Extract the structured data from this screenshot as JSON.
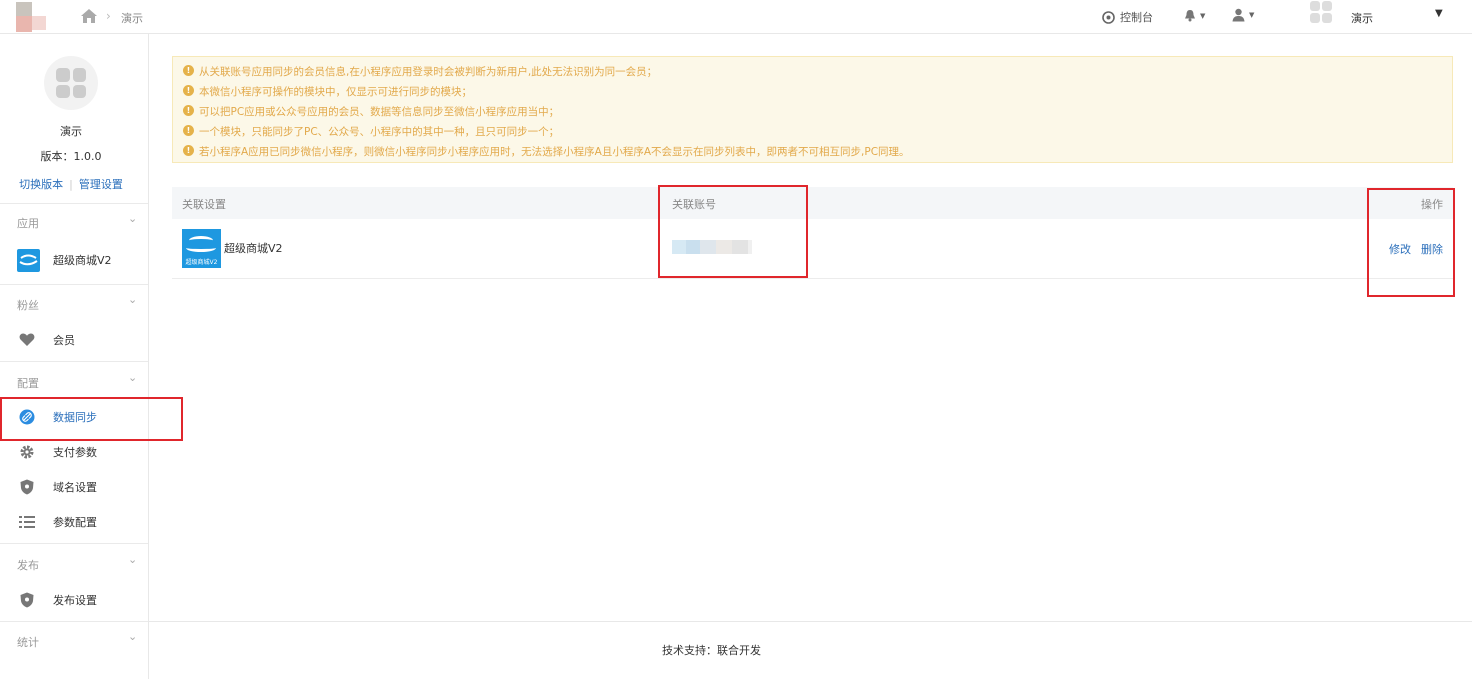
{
  "header": {
    "breadcrumb_current": "演示",
    "console_label": "控制台",
    "account_name": "演示"
  },
  "sidebar": {
    "app_name": "演示",
    "version": "版本：1.0.0",
    "switch_version": "切换版本",
    "manage_settings": "管理设置",
    "sections": [
      {
        "title": "应用",
        "items": [
          {
            "label": "超级商城V2",
            "icon": "app-logo-icon"
          }
        ]
      },
      {
        "title": "粉丝",
        "items": [
          {
            "label": "会员",
            "icon": "heart-icon"
          }
        ]
      },
      {
        "title": "配置",
        "items": [
          {
            "label": "数据同步",
            "icon": "link-icon",
            "active": true
          },
          {
            "label": "支付参数",
            "icon": "gear-icon"
          },
          {
            "label": "域名设置",
            "icon": "shield-icon"
          },
          {
            "label": "参数配置",
            "icon": "list-icon"
          }
        ]
      },
      {
        "title": "发布",
        "items": [
          {
            "label": "发布设置",
            "icon": "shield-icon"
          }
        ]
      },
      {
        "title": "统计",
        "items": []
      }
    ]
  },
  "notice": {
    "lines": [
      "从关联账号应用同步的会员信息,在小程序应用登录时会被判断为新用户,此处无法识别为同一会员；",
      "本微信小程序可操作的模块中，仅显示可进行同步的模块；",
      "可以把PC应用或公众号应用的会员、数据等信息同步至微信小程序应用当中；",
      "一个模块，只能同步了PC、公众号、小程序中的其中一种，且只可同步一个；",
      "若小程序A应用已同步微信小程序，则微信小程序同步小程序应用时，无法选择小程序A且小程序A不会显示在同步列表中，即两者不可相互同步,PC同理。"
    ]
  },
  "table": {
    "headers": [
      "关联设置",
      "关联账号",
      "操作"
    ],
    "rows": [
      {
        "module_name": "超级商城V2",
        "logo_text": "超级商城V2",
        "edit": "修改",
        "delete": "删除"
      }
    ]
  },
  "footer": {
    "text": "技术支持：联合开发"
  },
  "colors": {
    "accent": "#2b6fbb",
    "highlight": "#e0262c",
    "notice_text": "#e2a94b"
  }
}
